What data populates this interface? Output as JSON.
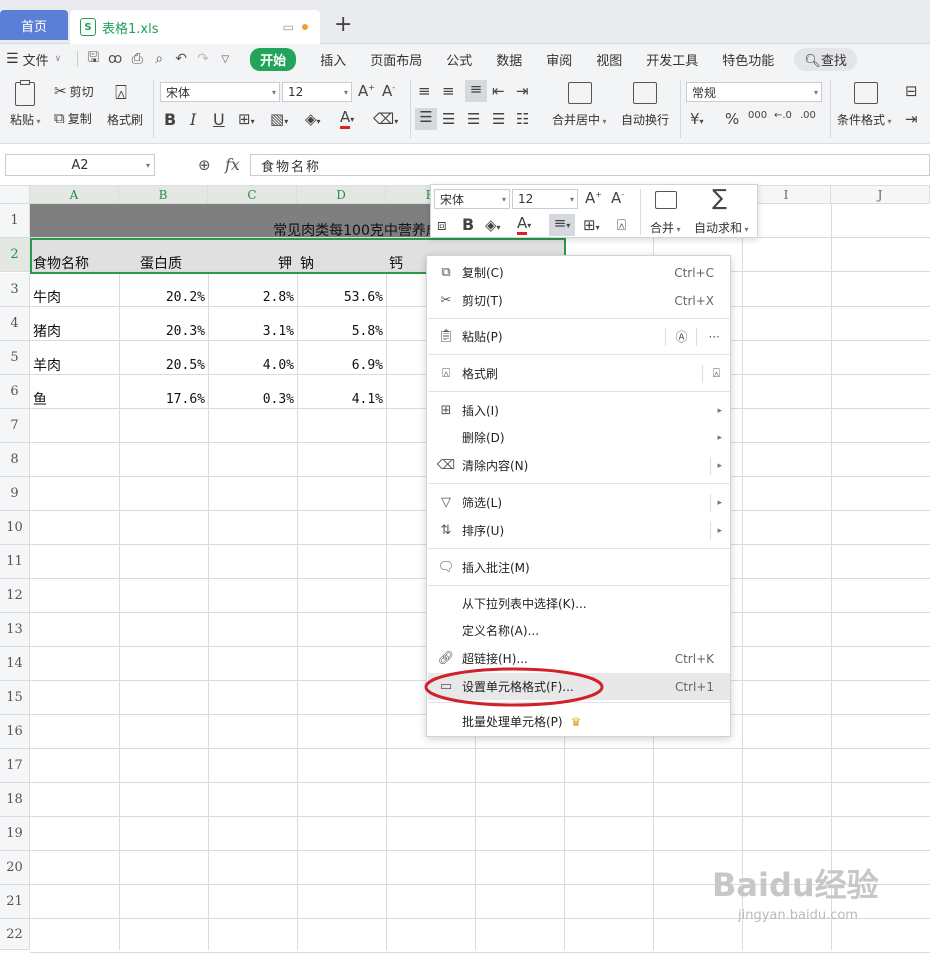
{
  "tabs": {
    "home": "首页",
    "file": "表格1.xls",
    "file_monitor_icon": "monitor-icon",
    "add": "+"
  },
  "menu": {
    "file": "文件",
    "items": [
      "开始",
      "插入",
      "页面布局",
      "公式",
      "数据",
      "审阅",
      "视图",
      "开发工具",
      "特色功能"
    ],
    "active": "开始",
    "search": "查找"
  },
  "ribbon": {
    "paste": "粘贴",
    "cut": "剪切",
    "copy": "复制",
    "format_painter": "格式刷",
    "font_name": "宋体",
    "font_size": "12",
    "merge_center": "合并居中",
    "auto_wrap": "自动换行",
    "number_format": "常规",
    "currency": "¥",
    "percent": "%",
    "thousands": "000",
    "cond_format": "条件格式",
    "bold": "B",
    "italic": "I",
    "underline": "U"
  },
  "formula_bar": {
    "cell_ref": "A2",
    "fx": "fx",
    "value": "食物名称"
  },
  "grid": {
    "columns": [
      "A",
      "B",
      "C",
      "D",
      "E",
      "F",
      "G",
      "H",
      "I",
      "J"
    ],
    "rows": [
      "1",
      "2",
      "3",
      "4",
      "5",
      "6",
      "7",
      "8",
      "9",
      "10",
      "11",
      "12",
      "13",
      "14",
      "15",
      "16",
      "17",
      "18",
      "19",
      "20",
      "21",
      "22"
    ],
    "title": "常见肉类每100克中营养成分含量",
    "header": [
      "食物名称",
      "蛋白质",
      "钾",
      "钠",
      "钙"
    ],
    "data": [
      [
        "牛肉",
        "20.2%",
        "2.8%",
        "53.6%"
      ],
      [
        "猪肉",
        "20.3%",
        "3.1%",
        "5.8%"
      ],
      [
        "羊肉",
        "20.5%",
        "4.0%",
        "6.9%"
      ],
      [
        "鱼",
        "17.6%",
        "0.3%",
        "4.1%"
      ]
    ]
  },
  "mini_toolbar": {
    "font_name": "宋体",
    "font_size": "12",
    "bold": "B",
    "merge": "合并",
    "autosum": "自动求和"
  },
  "context_menu": {
    "items": [
      {
        "label": "复制(C)",
        "shortcut": "Ctrl+C",
        "icon": "copy-icon"
      },
      {
        "label": "剪切(T)",
        "shortcut": "Ctrl+X",
        "icon": "cut-icon"
      },
      {
        "label": "粘贴(P)",
        "icon": "paste-icon"
      },
      {
        "label": "格式刷",
        "icon": "format-painter-icon"
      },
      {
        "label": "插入(I)",
        "icon": "insert-icon"
      },
      {
        "label": "删除(D)"
      },
      {
        "label": "清除内容(N)",
        "icon": "eraser-icon"
      },
      {
        "label": "筛选(L)",
        "icon": "filter-icon"
      },
      {
        "label": "排序(U)",
        "icon": "sort-icon"
      },
      {
        "label": "插入批注(M)",
        "icon": "comment-icon"
      },
      {
        "label": "从下拉列表中选择(K)..."
      },
      {
        "label": "定义名称(A)..."
      },
      {
        "label": "超链接(H)...",
        "shortcut": "Ctrl+K",
        "icon": "link-icon"
      },
      {
        "label": "设置单元格格式(F)...",
        "shortcut": "Ctrl+1",
        "icon": "format-cells-icon"
      },
      {
        "label": "批量处理单元格(P)",
        "icon": "crown-icon"
      }
    ],
    "more": "···"
  },
  "annotation_color": "#d0202a",
  "watermark": {
    "logo": "Baidu经验",
    "url": "jingyan.baidu.com"
  }
}
